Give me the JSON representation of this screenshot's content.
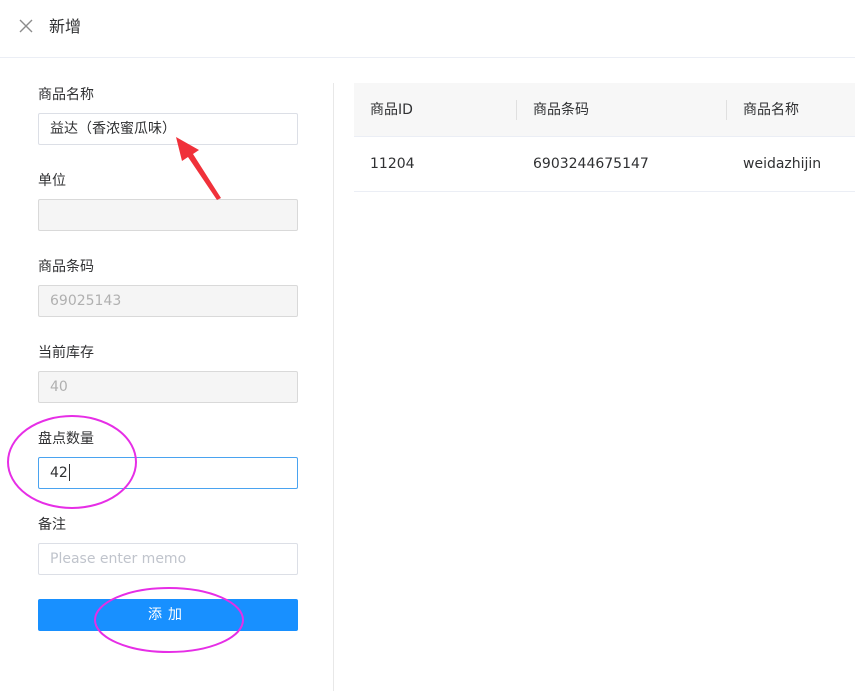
{
  "header": {
    "title": "新增",
    "close_icon": "close-icon"
  },
  "form": {
    "product_name": {
      "label": "商品名称",
      "value": "益达（香浓蜜瓜味）"
    },
    "unit": {
      "label": "单位",
      "value": ""
    },
    "barcode": {
      "label": "商品条码",
      "value": "69025143"
    },
    "current_stock": {
      "label": "当前库存",
      "value": "40"
    },
    "count_quantity": {
      "label": "盘点数量",
      "value": "42"
    },
    "memo": {
      "label": "备注",
      "placeholder": "Please enter memo"
    },
    "submit_label": "添加"
  },
  "table": {
    "columns": [
      "商品ID",
      "商品条码",
      "商品名称"
    ],
    "rows": [
      {
        "id": "11204",
        "barcode": "6903244675147",
        "name": "weidazhijin"
      }
    ]
  },
  "colors": {
    "primary": "#1890ff",
    "focus_border": "#4aa3f0",
    "annotation_arrow": "#f0313a",
    "annotation_circle": "#e62ee6"
  }
}
